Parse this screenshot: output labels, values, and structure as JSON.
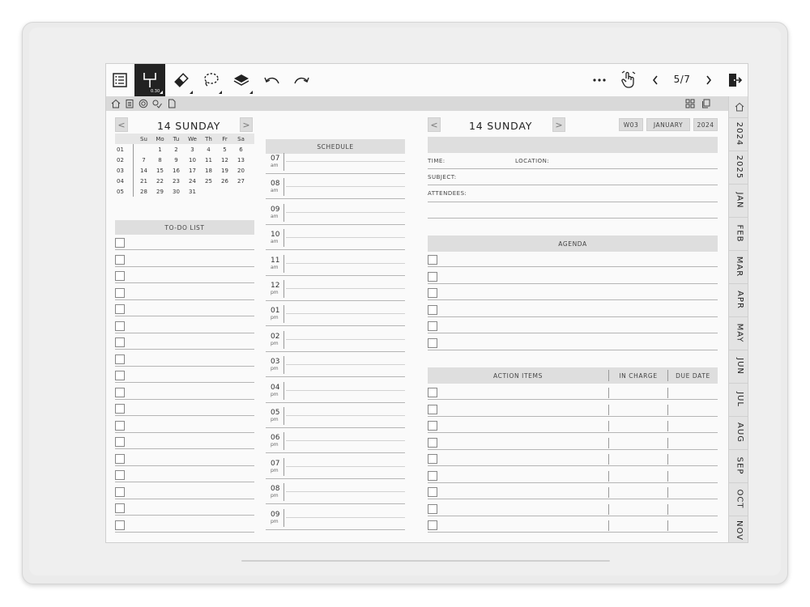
{
  "toolbar": {
    "pen_size": "0.30",
    "page_indicator": "5/7",
    "icons": [
      "menu-icon",
      "pen-icon",
      "eraser-icon",
      "lasso-icon",
      "layers-icon",
      "undo-icon",
      "redo-icon",
      "more-icon",
      "touch-icon",
      "prev-page-icon",
      "next-page-icon",
      "exit-icon"
    ]
  },
  "sidebar_tabs": [
    "2024",
    "2025",
    "JAN",
    "FEB",
    "MAR",
    "APR",
    "MAY",
    "JUN",
    "JUL",
    "AUG",
    "SEP",
    "OCT",
    "NOV"
  ],
  "left": {
    "date_title": "14 SUNDAY",
    "calendar": {
      "weekdays": [
        "Su",
        "Mo",
        "Tu",
        "We",
        "Th",
        "Fr",
        "Sa"
      ],
      "weeks": [
        {
          "wk": "01",
          "days": [
            "",
            "1",
            "2",
            "3",
            "4",
            "5",
            "6"
          ]
        },
        {
          "wk": "02",
          "days": [
            "7",
            "8",
            "9",
            "10",
            "11",
            "12",
            "13"
          ]
        },
        {
          "wk": "03",
          "days": [
            "14",
            "15",
            "16",
            "17",
            "18",
            "19",
            "20"
          ]
        },
        {
          "wk": "04",
          "days": [
            "21",
            "22",
            "23",
            "24",
            "25",
            "26",
            "27"
          ]
        },
        {
          "wk": "05",
          "days": [
            "28",
            "29",
            "30",
            "31",
            "",
            "",
            ""
          ]
        }
      ]
    },
    "todo_header": "TO-DO LIST",
    "todo_count": 18
  },
  "schedule": {
    "header": "SCHEDULE",
    "hours": [
      {
        "h": "07",
        "p": "am"
      },
      {
        "h": "08",
        "p": "am"
      },
      {
        "h": "09",
        "p": "am"
      },
      {
        "h": "10",
        "p": "am"
      },
      {
        "h": "11",
        "p": "am"
      },
      {
        "h": "12",
        "p": "pm"
      },
      {
        "h": "01",
        "p": "pm"
      },
      {
        "h": "02",
        "p": "pm"
      },
      {
        "h": "03",
        "p": "pm"
      },
      {
        "h": "04",
        "p": "pm"
      },
      {
        "h": "05",
        "p": "pm"
      },
      {
        "h": "06",
        "p": "pm"
      },
      {
        "h": "07",
        "p": "pm"
      },
      {
        "h": "08",
        "p": "pm"
      },
      {
        "h": "09",
        "p": "pm"
      }
    ]
  },
  "right": {
    "date_title": "14 SUNDAY",
    "week_chip": "W03",
    "month_chip": "JANUARY",
    "year_chip": "2024",
    "time_label": "TIME:",
    "location_label": "LOCATION:",
    "subject_label": "SUBJECT:",
    "attendees_label": "ATTENDEES:",
    "agenda_header": "AGENDA",
    "agenda_count": 6,
    "action_header": "ACTION ITEMS",
    "in_charge_header": "IN CHARGE",
    "due_date_header": "DUE DATE",
    "action_count": 9
  }
}
